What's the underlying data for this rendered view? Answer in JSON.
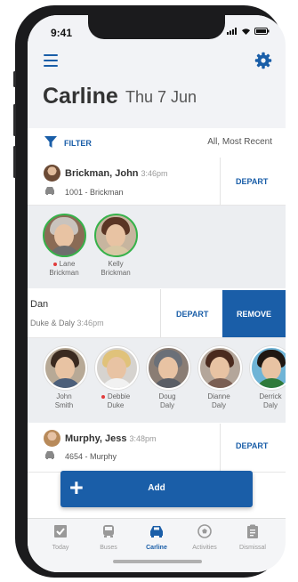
{
  "status": {
    "time": "9:41"
  },
  "header": {
    "title": "Carline",
    "date": "Thu 7 Jun"
  },
  "filter": {
    "label": "FILTER",
    "value": "All, Most Recent"
  },
  "entries": [
    {
      "name": "Brickman, John",
      "time": "3:46pm",
      "car": "1001 - Brickman",
      "action": "DEPART",
      "students": [
        {
          "first": "Lane",
          "last": "Brickman",
          "flag": true
        },
        {
          "first": "Kelly",
          "last": "Brickman",
          "flag": false
        }
      ]
    },
    {
      "name": "Dan",
      "time": "3:46pm",
      "car": "Duke & Daly",
      "action": "DEPART",
      "secondary_action": "REMOVE",
      "students": [
        {
          "first": "John",
          "last": "Smith",
          "flag": false
        },
        {
          "first": "Debbie",
          "last": "Duke",
          "flag": true
        },
        {
          "first": "Doug",
          "last": "Daly",
          "flag": false
        },
        {
          "first": "Dianne",
          "last": "Daly",
          "flag": false
        },
        {
          "first": "Derrick",
          "last": "Daly",
          "flag": false
        }
      ]
    },
    {
      "name": "Murphy, Jess",
      "time": "3:48pm",
      "car": "4654 - Murphy",
      "action": "DEPART"
    }
  ],
  "add_button": {
    "label": "Add"
  },
  "tabs": [
    {
      "label": "Today",
      "icon": "checkbox-icon"
    },
    {
      "label": "Buses",
      "icon": "bus-icon"
    },
    {
      "label": "Carline",
      "icon": "car-icon",
      "active": true
    },
    {
      "label": "Activities",
      "icon": "soccer-ball-icon"
    },
    {
      "label": "Dismissal",
      "icon": "clipboard-icon"
    }
  ],
  "colors": {
    "accent": "#1a5ea8",
    "present": "#36b24a",
    "alert": "#e23b3b"
  }
}
